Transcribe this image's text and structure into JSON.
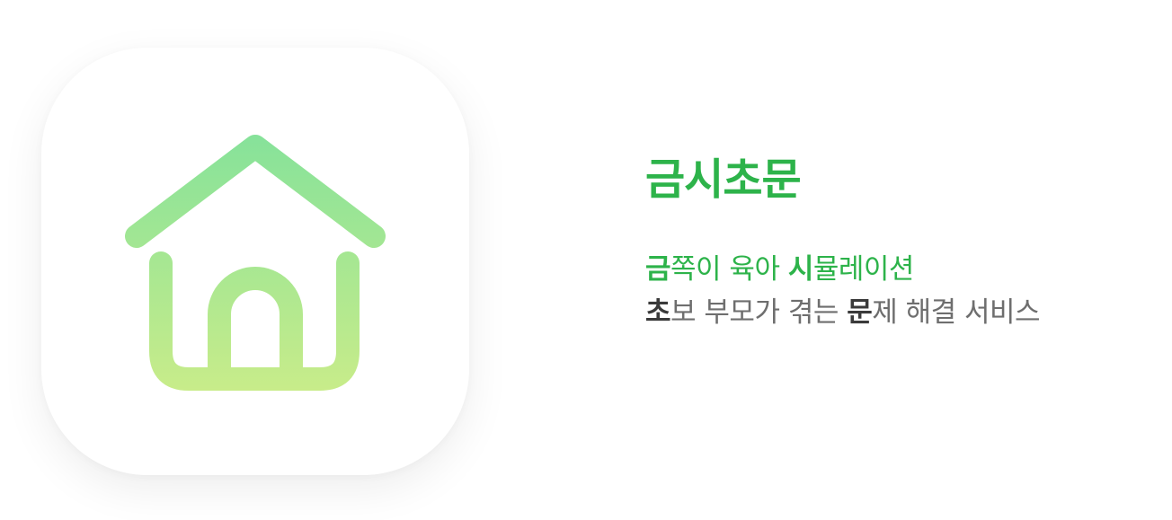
{
  "app": {
    "name": "금시초문"
  },
  "tagline": {
    "line1": {
      "segments": [
        {
          "text": "금",
          "emphasis": true
        },
        {
          "text": "쪽이 육아 ",
          "emphasis": false
        },
        {
          "text": "시",
          "emphasis": true
        },
        {
          "text": "뮬레이션",
          "emphasis": false
        }
      ]
    },
    "line2": {
      "segments": [
        {
          "text": "초",
          "emphasis": true
        },
        {
          "text": "보 부모가 겪는 ",
          "emphasis": false
        },
        {
          "text": "문",
          "emphasis": true
        },
        {
          "text": "제 해결 서비스",
          "emphasis": false
        }
      ]
    }
  },
  "icon": {
    "semantic": "house-icon",
    "gradient_top": "#86E29A",
    "gradient_bottom": "#C8EC8A"
  },
  "colors": {
    "brand_green": "#2DB34A",
    "muted_gray": "#6E6E6E",
    "emphasis_dark": "#3A3A3A",
    "background": "#FFFFFF"
  }
}
